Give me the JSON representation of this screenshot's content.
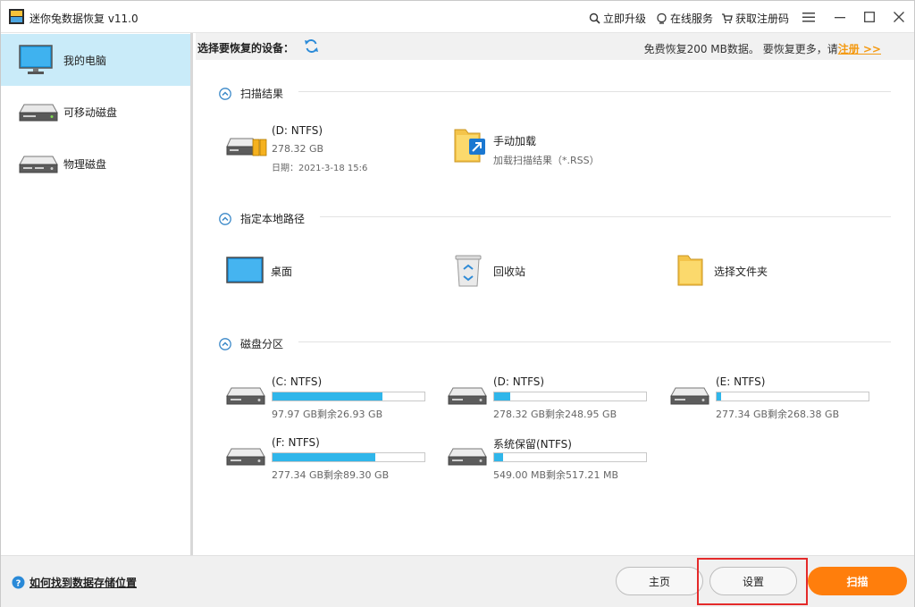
{
  "window": {
    "title": "迷你兔数据恢复 v11.0"
  },
  "toolbar": {
    "upgrade": "立即升级",
    "service": "在线服务",
    "register": "获取注册码"
  },
  "sidebar": {
    "items": [
      {
        "label": "我的电脑",
        "icon": "monitor-icon"
      },
      {
        "label": "可移动磁盘",
        "icon": "removable-drive-icon"
      },
      {
        "label": "物理磁盘",
        "icon": "physical-disk-icon"
      }
    ]
  },
  "devbar": {
    "title": "选择要恢复的设备：",
    "note": "免费恢复200 MB数据。 要恢复更多，请",
    "register_link": "注册 >>"
  },
  "sections": {
    "scan": {
      "title": "扫描结果",
      "result": {
        "name": "(D: NTFS)",
        "size": "278.32 GB",
        "date": "日期：2021-3-18 15:6"
      },
      "manual": {
        "name": "手动加载",
        "sub": "加载扫描结果（*.RSS）"
      }
    },
    "local": {
      "title": "指定本地路径",
      "items": [
        "桌面",
        "回收站",
        "选择文件夹"
      ]
    },
    "partitions": {
      "title": "磁盘分区",
      "items": [
        {
          "name": "(C: NTFS)",
          "detail": "97.97 GB剩余26.93 GB",
          "used": 0.725
        },
        {
          "name": "(D: NTFS)",
          "detail": "278.32 GB剩余248.95 GB",
          "used": 0.105
        },
        {
          "name": "(E: NTFS)",
          "detail": "277.34 GB剩余268.38 GB",
          "used": 0.032
        },
        {
          "name": "(F: NTFS)",
          "detail": "277.34 GB剩余89.30 GB",
          "used": 0.678
        },
        {
          "name": "系统保留(NTFS)",
          "detail": "549.00 MB剩余517.21 MB",
          "used": 0.058
        }
      ]
    }
  },
  "footer": {
    "help": "如何找到数据存储位置",
    "home": "主页",
    "settings": "设置",
    "scan": "扫描"
  },
  "colors": {
    "accent": "#30b6ea",
    "primary_button": "#ff7e0c",
    "link": "#f49a12",
    "active_sidebar": "#c9ebf9",
    "highlight": "#e42a2a"
  }
}
